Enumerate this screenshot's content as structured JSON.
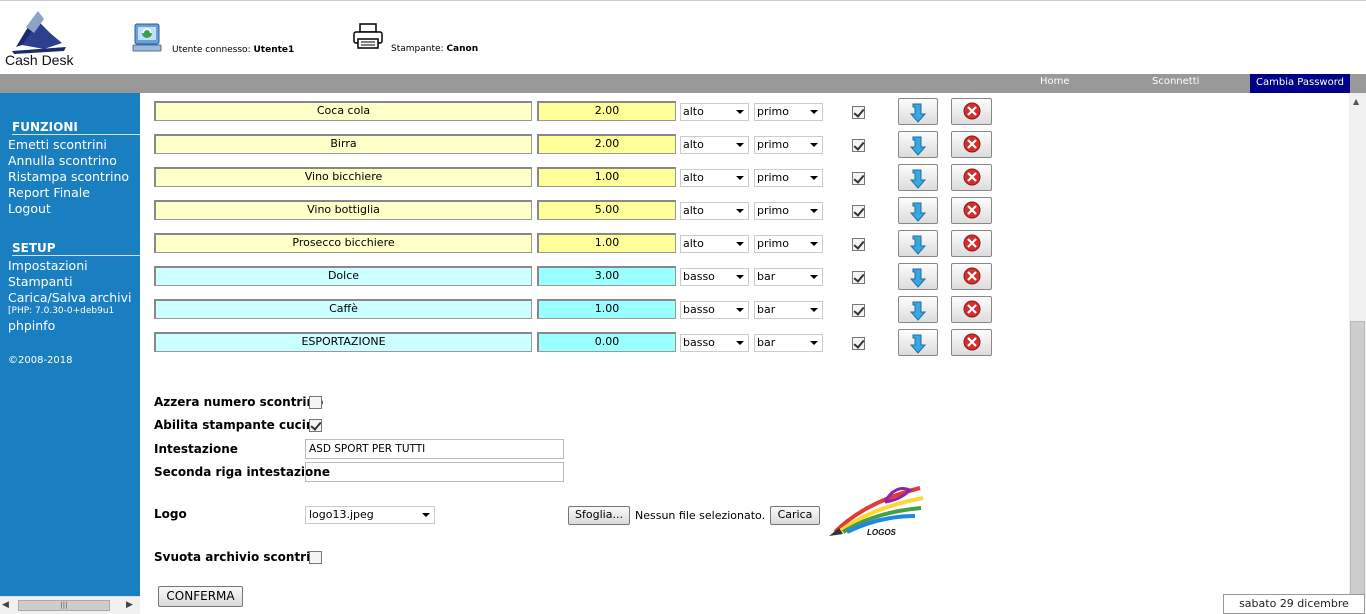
{
  "header": {
    "app_name": "Cash Desk",
    "user_label": "Utente connesso:",
    "user_value": "Utente1",
    "printer_label": "Stampante:",
    "printer_value": "Canon"
  },
  "nav": {
    "home": "Home",
    "disconnect": "Sconnetti",
    "change_password": "Cambia Password"
  },
  "sidebar": {
    "functions_title": "FUNZIONI",
    "functions": [
      "Emetti scontrini",
      "Annulla scontrino",
      "Ristampa scontrino",
      "Report Finale",
      "Logout"
    ],
    "setup_title": "SETUP",
    "setup": [
      "Impostazioni",
      "Stampanti",
      "Carica/Salva archivi"
    ],
    "php_version": "[PHP: 7.0.30-0+deb9u1",
    "phpinfo": "phpinfo",
    "copyright": "©2008-2018"
  },
  "products": [
    {
      "name": "Coca cola",
      "price": "2.00",
      "level": "alto",
      "course": "primo",
      "enabled": true,
      "color": "yellow"
    },
    {
      "name": "Birra",
      "price": "2.00",
      "level": "alto",
      "course": "primo",
      "enabled": true,
      "color": "yellow"
    },
    {
      "name": "Vino bicchiere",
      "price": "1.00",
      "level": "alto",
      "course": "primo",
      "enabled": true,
      "color": "yellow"
    },
    {
      "name": "Vino bottiglia",
      "price": "5.00",
      "level": "alto",
      "course": "primo",
      "enabled": true,
      "color": "yellow"
    },
    {
      "name": "Prosecco bicchiere",
      "price": "1.00",
      "level": "alto",
      "course": "primo",
      "enabled": true,
      "color": "yellow"
    },
    {
      "name": "Dolce",
      "price": "3.00",
      "level": "basso",
      "course": "bar",
      "enabled": true,
      "color": "cyan"
    },
    {
      "name": "Caffè",
      "price": "1.00",
      "level": "basso",
      "course": "bar",
      "enabled": true,
      "color": "cyan"
    },
    {
      "name": "ESPORTAZIONE",
      "price": "0.00",
      "level": "basso",
      "course": "bar",
      "enabled": true,
      "color": "cyan"
    }
  ],
  "settings": {
    "reset_receipt_label": "Azzera numero scontrino",
    "reset_receipt_checked": false,
    "kitchen_printer_label": "Abilita stampante cucina",
    "kitchen_printer_checked": true,
    "header_label": "Intestazione",
    "header_value": "ASD SPORT PER TUTTI",
    "header2_label": "Seconda riga intestazione",
    "header2_value": "",
    "logo_label": "Logo",
    "logo_value": "logo13.jpeg",
    "browse_button": "Sfoglia...",
    "no_file_text": "Nessun file selezionato.",
    "upload_button": "Carica",
    "logo_caption": "LOGOS",
    "empty_archive_label": "Svuota archivio scontrini",
    "empty_archive_checked": false,
    "confirm_button": "CONFERMA"
  },
  "footer": {
    "date": "sabato 29 dicembre 2018"
  },
  "colors": {
    "sidebar_bg": "#1a7fc1",
    "navbar_bg": "#999999",
    "active_nav_bg": "#000088",
    "yellow_row": "#ffffc8",
    "yellow_price": "#ffff99",
    "cyan_row": "#ccffff",
    "cyan_price": "#99ffff"
  }
}
